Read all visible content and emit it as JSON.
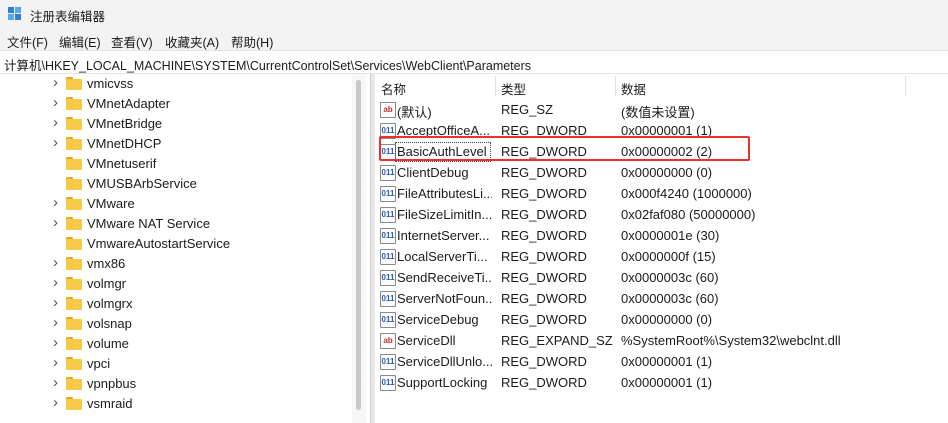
{
  "window": {
    "title": "注册表编辑器"
  },
  "menu": [
    "文件(F)",
    "编辑(E)",
    "查看(V)",
    "收藏夹(A)",
    "帮助(H)"
  ],
  "address": "计算机\\HKEY_LOCAL_MACHINE\\SYSTEM\\CurrentControlSet\\Services\\WebClient\\Parameters",
  "tree": [
    {
      "label": "vmicvss",
      "expandable": true
    },
    {
      "label": "VMnetAdapter",
      "expandable": true
    },
    {
      "label": "VMnetBridge",
      "expandable": true
    },
    {
      "label": "VMnetDHCP",
      "expandable": true
    },
    {
      "label": "VMnetuserif",
      "expandable": false
    },
    {
      "label": "VMUSBArbService",
      "expandable": false
    },
    {
      "label": "VMware",
      "expandable": true
    },
    {
      "label": "VMware NAT Service",
      "expandable": true
    },
    {
      "label": "VmwareAutostartService",
      "expandable": false
    },
    {
      "label": "vmx86",
      "expandable": true
    },
    {
      "label": "volmgr",
      "expandable": true
    },
    {
      "label": "volmgrx",
      "expandable": true
    },
    {
      "label": "volsnap",
      "expandable": true
    },
    {
      "label": "volume",
      "expandable": true
    },
    {
      "label": "vpci",
      "expandable": true
    },
    {
      "label": "vpnpbus",
      "expandable": true
    },
    {
      "label": "vsmraid",
      "expandable": true
    }
  ],
  "columns": {
    "name": "名称",
    "type": "类型",
    "data": "数据"
  },
  "values": [
    {
      "icon": "string-value-icon",
      "name": "(默认)",
      "type": "REG_SZ",
      "data": "(数值未设置)"
    },
    {
      "icon": "dword-value-icon",
      "name": "AcceptOfficeA...",
      "type": "REG_DWORD",
      "data": "0x00000001 (1)"
    },
    {
      "icon": "dword-value-icon",
      "name": "BasicAuthLevel",
      "type": "REG_DWORD",
      "data": "0x00000002 (2)",
      "selected": true
    },
    {
      "icon": "dword-value-icon",
      "name": "ClientDebug",
      "type": "REG_DWORD",
      "data": "0x00000000 (0)"
    },
    {
      "icon": "dword-value-icon",
      "name": "FileAttributesLi...",
      "type": "REG_DWORD",
      "data": "0x000f4240 (1000000)"
    },
    {
      "icon": "dword-value-icon",
      "name": "FileSizeLimitIn...",
      "type": "REG_DWORD",
      "data": "0x02faf080 (50000000)"
    },
    {
      "icon": "dword-value-icon",
      "name": "InternetServer...",
      "type": "REG_DWORD",
      "data": "0x0000001e (30)"
    },
    {
      "icon": "dword-value-icon",
      "name": "LocalServerTi...",
      "type": "REG_DWORD",
      "data": "0x0000000f (15)"
    },
    {
      "icon": "dword-value-icon",
      "name": "SendReceiveTi...",
      "type": "REG_DWORD",
      "data": "0x0000003c (60)"
    },
    {
      "icon": "dword-value-icon",
      "name": "ServerNotFoun...",
      "type": "REG_DWORD",
      "data": "0x0000003c (60)"
    },
    {
      "icon": "dword-value-icon",
      "name": "ServiceDebug",
      "type": "REG_DWORD",
      "data": "0x00000000 (0)"
    },
    {
      "icon": "string-value-icon",
      "name": "ServiceDll",
      "type": "REG_EXPAND_SZ",
      "data": "%SystemRoot%\\System32\\webclnt.dll"
    },
    {
      "icon": "dword-value-icon",
      "name": "ServiceDllUnlo...",
      "type": "REG_DWORD",
      "data": "0x00000001 (1)"
    },
    {
      "icon": "dword-value-icon",
      "name": "SupportLocking",
      "type": "REG_DWORD",
      "data": "0x00000001 (1)"
    }
  ],
  "colors": {
    "highlight": "#e8322b",
    "folder": "#f7c84a"
  }
}
